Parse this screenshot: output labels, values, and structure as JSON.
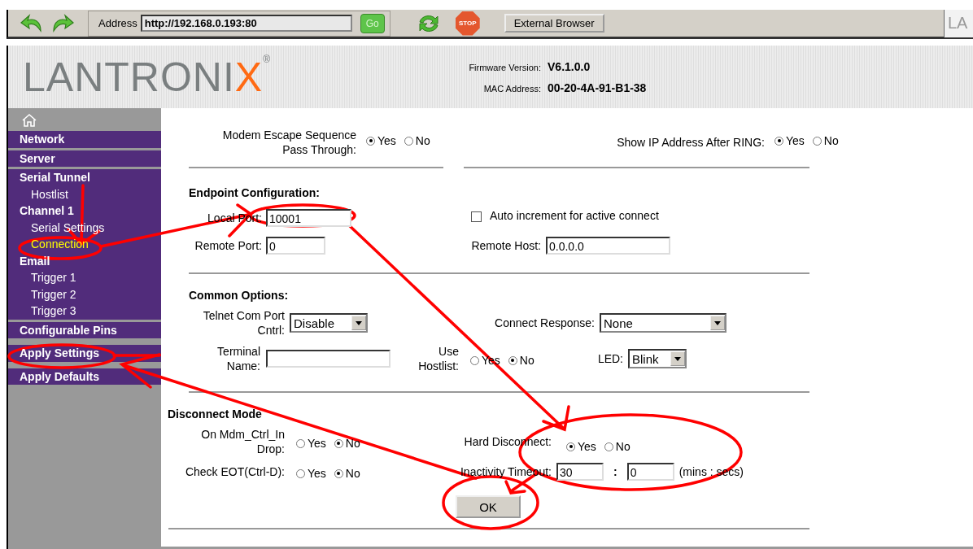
{
  "toolbar": {
    "address_label": "Address",
    "address": "http://192.168.0.193:80",
    "go": "Go",
    "stop": "STOP",
    "external_browser": "External Browser",
    "tab_logo": "LA"
  },
  "header": {
    "logo": "LANTRONI",
    "logo_accent": "X",
    "logo_mark": "®",
    "firmware_label": "Firmware Version:",
    "firmware": "V6.1.0.0",
    "mac_label": "MAC Address:",
    "mac": "00-20-4A-91-B1-38"
  },
  "sidebar": {
    "groups": [
      [
        {
          "label": "Network",
          "kind": "header",
          "selected": false
        }
      ],
      [
        {
          "label": "Server",
          "kind": "header",
          "selected": false
        }
      ],
      [
        {
          "label": "Serial Tunnel",
          "kind": "header",
          "selected": false
        },
        {
          "label": "Hostlist",
          "kind": "sub",
          "selected": false
        },
        {
          "label": "Channel 1",
          "kind": "header",
          "selected": false
        },
        {
          "label": "Serial Settings",
          "kind": "sub",
          "selected": false
        },
        {
          "label": "Connection",
          "kind": "sub",
          "selected": true
        },
        {
          "label": "Email",
          "kind": "header",
          "selected": false
        },
        {
          "label": "Trigger 1",
          "kind": "sub",
          "selected": false
        },
        {
          "label": "Trigger 2",
          "kind": "sub",
          "selected": false
        },
        {
          "label": "Trigger 3",
          "kind": "sub",
          "selected": false
        }
      ],
      [
        {
          "label": "Configurable Pins",
          "kind": "header",
          "selected": false
        }
      ],
      [
        {
          "label": "Apply Settings",
          "kind": "header",
          "selected": false
        }
      ],
      [
        {
          "label": "Apply Defaults",
          "kind": "header",
          "selected": false
        }
      ]
    ]
  },
  "modem": {
    "escape_label": [
      "Modem Escape Sequence",
      "Pass Through:"
    ],
    "escape_options": [
      {
        "label": "Yes",
        "selected": true
      },
      {
        "label": "No",
        "selected": false
      }
    ],
    "show_ip_label": "Show IP Address After RING:",
    "show_ip_options": [
      {
        "label": "Yes",
        "selected": true
      },
      {
        "label": "No",
        "selected": false
      }
    ]
  },
  "endpoint": {
    "title": "Endpoint Configuration:",
    "local_port_label": "Local Port:",
    "local_port": "10001",
    "auto_increment": {
      "label": "Auto increment for active connect",
      "checked": false
    },
    "remote_port_label": "Remote Port:",
    "remote_port": "0",
    "remote_host_label": "Remote Host:",
    "remote_host": "0.0.0.0"
  },
  "common": {
    "title": "Common Options:",
    "telnet_label": [
      "Telnet Com Port",
      "Cntrl:"
    ],
    "telnet": "Disable",
    "connect_response_label": "Connect Response:",
    "connect_response": "None",
    "terminal_name_label": [
      "Terminal",
      "Name:"
    ],
    "use_hostlist_label": [
      "Use",
      "Hostlist:"
    ],
    "use_hostlist_options": [
      {
        "label": "Yes",
        "selected": false
      },
      {
        "label": "No",
        "selected": true
      }
    ],
    "led_label": "LED:",
    "led": "Blink"
  },
  "disconnect": {
    "title": "Disconnect Mode",
    "mdm_label": [
      "On Mdm_Ctrl_In",
      "Drop:"
    ],
    "mdm_options": [
      {
        "label": "Yes",
        "selected": false
      },
      {
        "label": "No",
        "selected": true
      }
    ],
    "hard_label": "Hard Disconnect:",
    "hard_options": [
      {
        "label": "Yes",
        "selected": true
      },
      {
        "label": "No",
        "selected": false
      }
    ],
    "eot_label": "Check EOT(Ctrl-D):",
    "eot_options": [
      {
        "label": "Yes",
        "selected": false
      },
      {
        "label": "No",
        "selected": true
      }
    ],
    "timeout_label": "Inactivity Timeout:",
    "timeout_mins": "30",
    "timeout_sep": ":",
    "timeout_secs": "0",
    "timeout_units": "(mins : secs)"
  },
  "ok": "OK"
}
